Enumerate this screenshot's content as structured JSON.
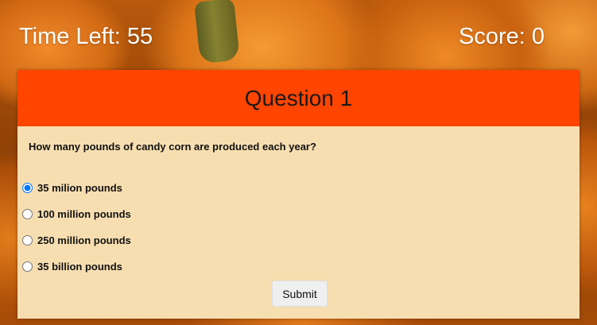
{
  "hud": {
    "time_left": "Time Left: 55",
    "score": "Score: 0"
  },
  "quiz": {
    "title": "Question 1",
    "question": "How many pounds of candy corn are produced each year?",
    "options": [
      {
        "label": "35 milion pounds",
        "selected": true
      },
      {
        "label": "100 million pounds",
        "selected": false
      },
      {
        "label": "250 million pounds",
        "selected": false
      },
      {
        "label": "35 billion pounds",
        "selected": false
      }
    ],
    "submit_label": "Submit"
  },
  "colors": {
    "header": "#ff4500",
    "card": "#f7deb0",
    "background": "#d2691e"
  }
}
